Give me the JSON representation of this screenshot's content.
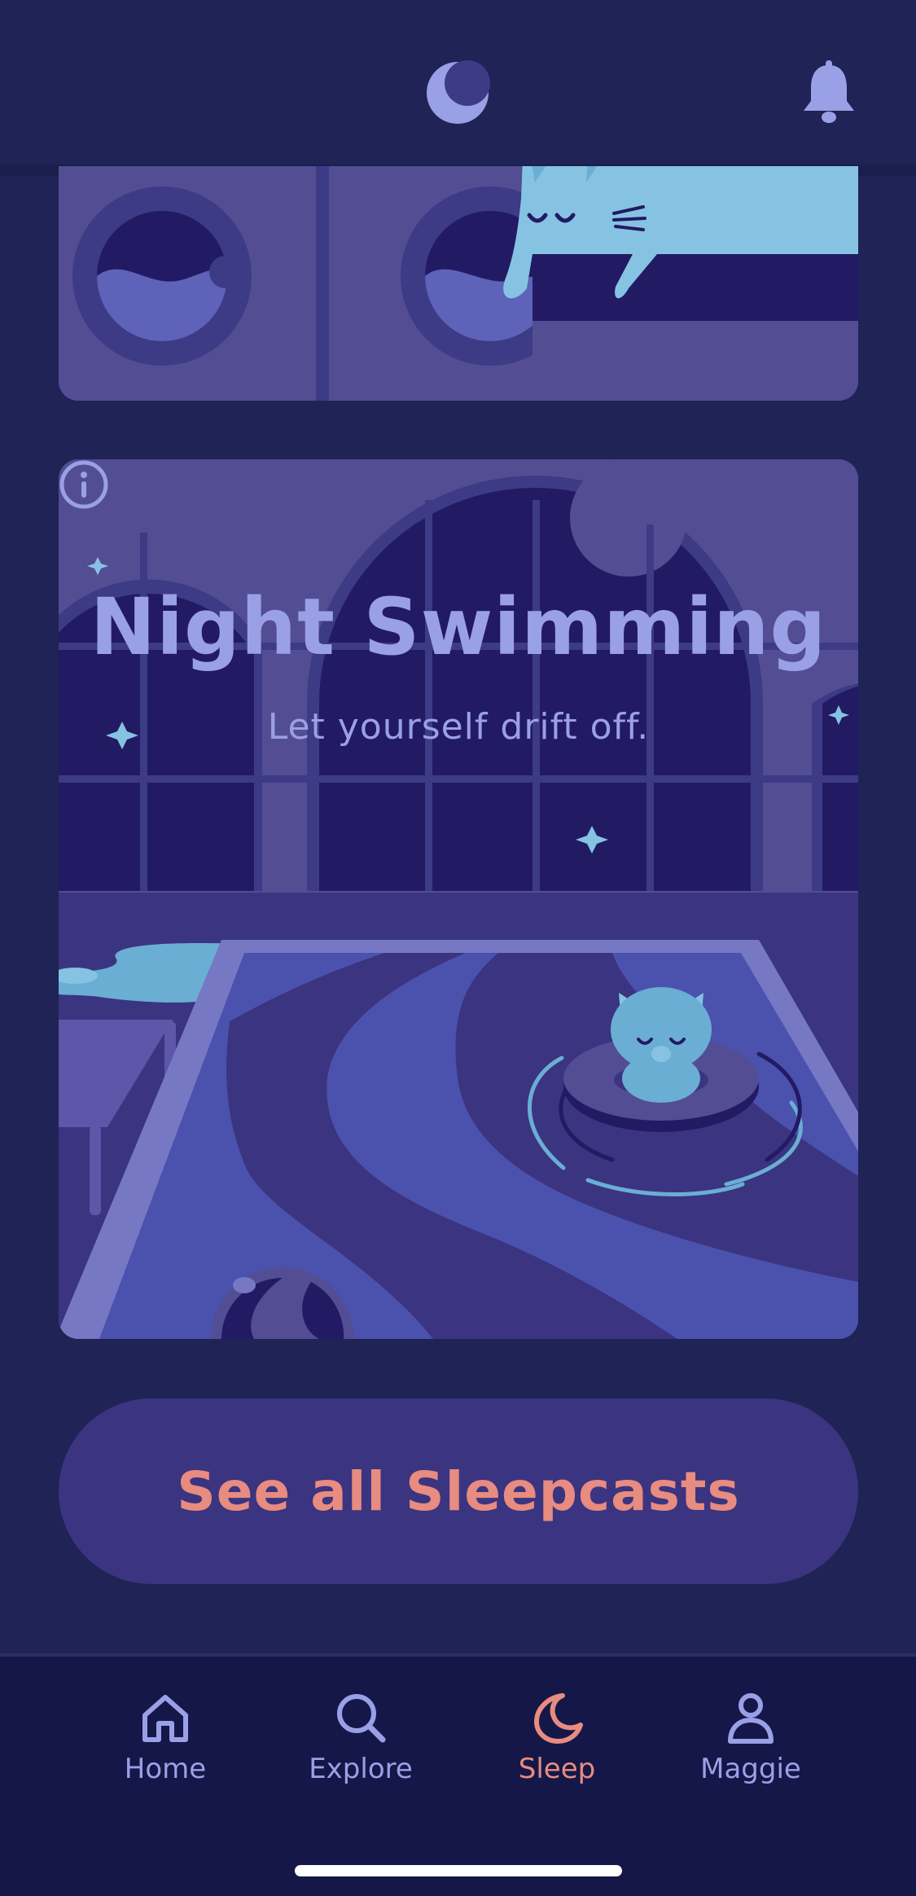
{
  "header": {
    "logo_icon": "moon-logo-icon",
    "notification_icon": "bell-icon"
  },
  "featured": {
    "title": "Night Swimming",
    "subtitle": "Let yourself drift off.",
    "info_icon": "info-icon"
  },
  "cta": {
    "label": "See all Sleepcasts"
  },
  "tabs": [
    {
      "label": "Home",
      "icon": "home-icon",
      "active": false
    },
    {
      "label": "Explore",
      "icon": "search-icon",
      "active": false
    },
    {
      "label": "Sleep",
      "icon": "moon-icon",
      "active": true
    },
    {
      "label": "Maggie",
      "icon": "profile-icon",
      "active": false
    }
  ],
  "colors": {
    "background": "#1f2355",
    "card": "#534d94",
    "accent": "#e88b80",
    "text_muted": "#9aa0e6",
    "tabbar": "#141748"
  }
}
